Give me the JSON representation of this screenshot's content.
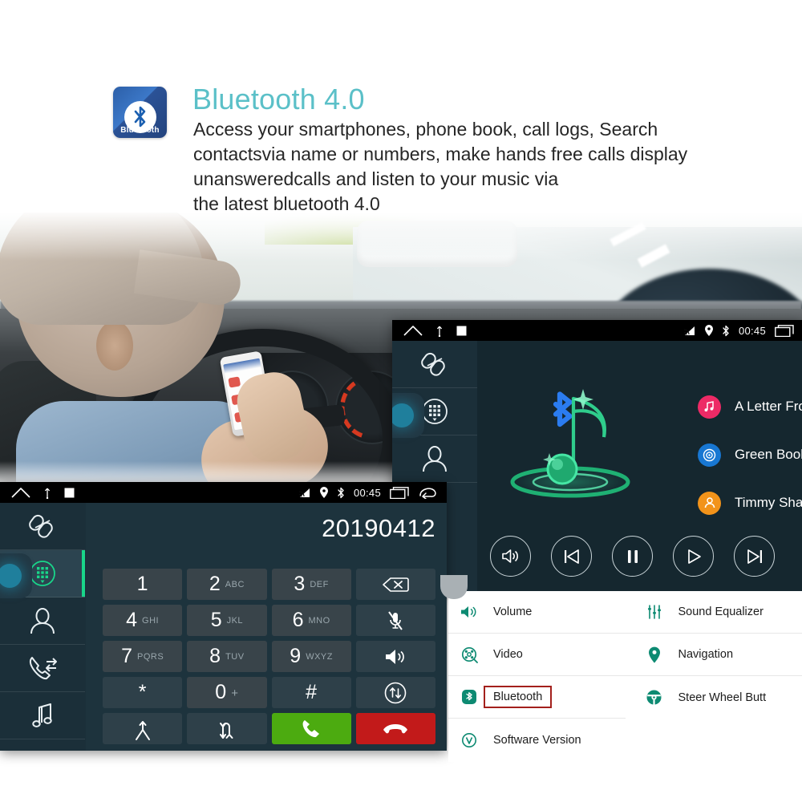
{
  "header": {
    "logo_text": "Bluetooth",
    "logo_icon": "bluetooth-icon",
    "title": "Bluetooth 4.0",
    "title_color": "#5bc0c8",
    "body": "Access your smartphones, phone book, call logs, Search\ncontactsvia name or numbers, make hands free calls display\n unansweredcalls  and listen to your music via\n  the latest bluetooth 4.0"
  },
  "photo": {
    "alt": "driver-using-phone-while-driving"
  },
  "music_device": {
    "statusbar": {
      "home_icon": "home-icon",
      "usb_icon": "usb-icon",
      "square_icon": "stop-square-icon",
      "cast_icon": "cast-icon",
      "location_icon": "location-pin-icon",
      "bluetooth_icon": "bluetooth-icon",
      "time": "00:45",
      "recents_icon": "recents-icon"
    },
    "sidebar": [
      {
        "name": "sidebar-item-disconnect",
        "icon": "broken-link-icon",
        "active": false
      },
      {
        "name": "sidebar-item-dialpad",
        "icon": "dialpad-icon",
        "active": false
      },
      {
        "name": "sidebar-item-contacts",
        "icon": "person-icon",
        "active": false
      }
    ],
    "artwork_icon": "bluetooth-music-note-icon",
    "tracks": [
      {
        "badge": "music-note-icon",
        "badge_color": "#ed2a66",
        "text": "A Letter From My Baby"
      },
      {
        "badge": "disc-icon",
        "badge_color": "#1877d2",
        "text": "Green Book (Original M"
      },
      {
        "badge": "artist-icon",
        "badge_color": "#f2931a",
        "text": "Timmy Shaw"
      }
    ],
    "controls": [
      {
        "name": "volume-button",
        "icon": "speaker-icon"
      },
      {
        "name": "previous-button",
        "icon": "skip-previous-icon"
      },
      {
        "name": "pause-button",
        "icon": "pause-icon"
      },
      {
        "name": "play-button",
        "icon": "play-icon"
      },
      {
        "name": "next-button",
        "icon": "skip-next-icon"
      }
    ]
  },
  "dial_device": {
    "statusbar": {
      "home_icon": "home-icon",
      "usb_icon": "usb-icon",
      "square_icon": "stop-square-icon",
      "cast_icon": "cast-icon",
      "location_icon": "location-pin-icon",
      "bluetooth_icon": "bluetooth-icon",
      "time": "00:45",
      "recents_icon": "recents-icon",
      "back_icon": "back-arrow-icon"
    },
    "sidebar": [
      {
        "name": "sidebar-item-disconnect",
        "icon": "broken-link-icon",
        "active": false
      },
      {
        "name": "sidebar-item-dialpad",
        "icon": "dialpad-icon",
        "active": true
      },
      {
        "name": "sidebar-item-contacts",
        "icon": "person-icon",
        "active": false
      },
      {
        "name": "sidebar-item-call-history",
        "icon": "call-transfer-icon",
        "active": false
      },
      {
        "name": "sidebar-item-music",
        "icon": "music-note-icon",
        "active": false
      }
    ],
    "number": "20190412",
    "keys": [
      {
        "name": "key-1",
        "big": "1",
        "sub": ""
      },
      {
        "name": "key-2",
        "big": "2",
        "sub": "ABC"
      },
      {
        "name": "key-3",
        "big": "3",
        "sub": "DEF"
      },
      {
        "name": "key-backspace",
        "icon": "backspace-icon"
      },
      {
        "name": "key-4",
        "big": "4",
        "sub": "GHI"
      },
      {
        "name": "key-5",
        "big": "5",
        "sub": "JKL"
      },
      {
        "name": "key-6",
        "big": "6",
        "sub": "MNO"
      },
      {
        "name": "key-mute",
        "icon": "mic-off-icon"
      },
      {
        "name": "key-7",
        "big": "7",
        "sub": "PQRS"
      },
      {
        "name": "key-8",
        "big": "8",
        "sub": "TUV"
      },
      {
        "name": "key-9",
        "big": "9",
        "sub": "WXYZ"
      },
      {
        "name": "key-speaker",
        "icon": "speaker-icon"
      },
      {
        "name": "key-star",
        "big": "*",
        "sub": ""
      },
      {
        "name": "key-0",
        "big": "0",
        "sub": "+"
      },
      {
        "name": "key-hash",
        "big": "#",
        "sub": ""
      },
      {
        "name": "key-switch-audio",
        "icon": "transfer-updown-icon"
      },
      {
        "name": "key-merge-call",
        "icon": "merge-call-icon"
      },
      {
        "name": "key-swap-call",
        "icon": "swap-call-icon"
      },
      {
        "name": "key-call",
        "icon": "phone-call-icon"
      },
      {
        "name": "key-hangup",
        "icon": "phone-hangup-icon"
      }
    ]
  },
  "settings": {
    "accent_color": "#0d8a72",
    "highlight_color": "#a3201c",
    "left_column": [
      {
        "name": "settings-item-volume",
        "icon": "volume-icon",
        "label": "Volume",
        "highlighted": false
      },
      {
        "name": "settings-item-video",
        "icon": "video-icon",
        "label": "Video",
        "highlighted": false
      },
      {
        "name": "settings-item-bluetooth",
        "icon": "bluetooth-icon",
        "label": "Bluetooth",
        "highlighted": true
      },
      {
        "name": "settings-item-software-version",
        "icon": "version-icon",
        "label": "Software Version",
        "highlighted": false
      }
    ],
    "right_column": [
      {
        "name": "settings-item-sound-equalizer",
        "icon": "equalizer-icon",
        "label": "Sound Equalizer",
        "highlighted": false
      },
      {
        "name": "settings-item-navigation",
        "icon": "location-pin-icon",
        "label": "Navigation",
        "highlighted": false
      },
      {
        "name": "settings-item-steer-wheel-button",
        "icon": "steering-wheel-icon",
        "label": "Steer Wheel Butt",
        "highlighted": false
      }
    ]
  }
}
